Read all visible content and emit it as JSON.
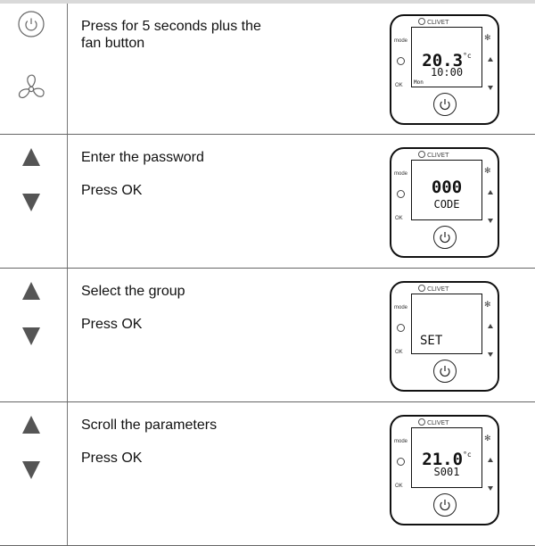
{
  "steps": [
    {
      "text": "Press for 5 seconds plus the\nfan button",
      "icons": [
        "power-button-icon",
        "fan-icon"
      ],
      "display": {
        "big": "20.3",
        "unit": "°c",
        "small": "10:00",
        "corner": "Mon"
      }
    },
    {
      "text1": "Enter the password",
      "text2": "Press OK",
      "icons": [
        "arrow-up-icon",
        "arrow-down-icon"
      ],
      "display": {
        "big": "000",
        "small": "CODE"
      }
    },
    {
      "text1": "Select the group",
      "text2": "Press OK",
      "icons": [
        "arrow-up-icon",
        "arrow-down-icon"
      ],
      "display": {
        "left": "SET"
      }
    },
    {
      "text1": "Scroll the parameters",
      "text2": "Press OK",
      "icons": [
        "arrow-up-icon",
        "arrow-down-icon"
      ],
      "display": {
        "big": "21.0",
        "unit": "°c",
        "small": "S001"
      }
    }
  ],
  "device": {
    "brand": "CLIVET",
    "mode_label": "mode",
    "ok_label": "OK"
  }
}
